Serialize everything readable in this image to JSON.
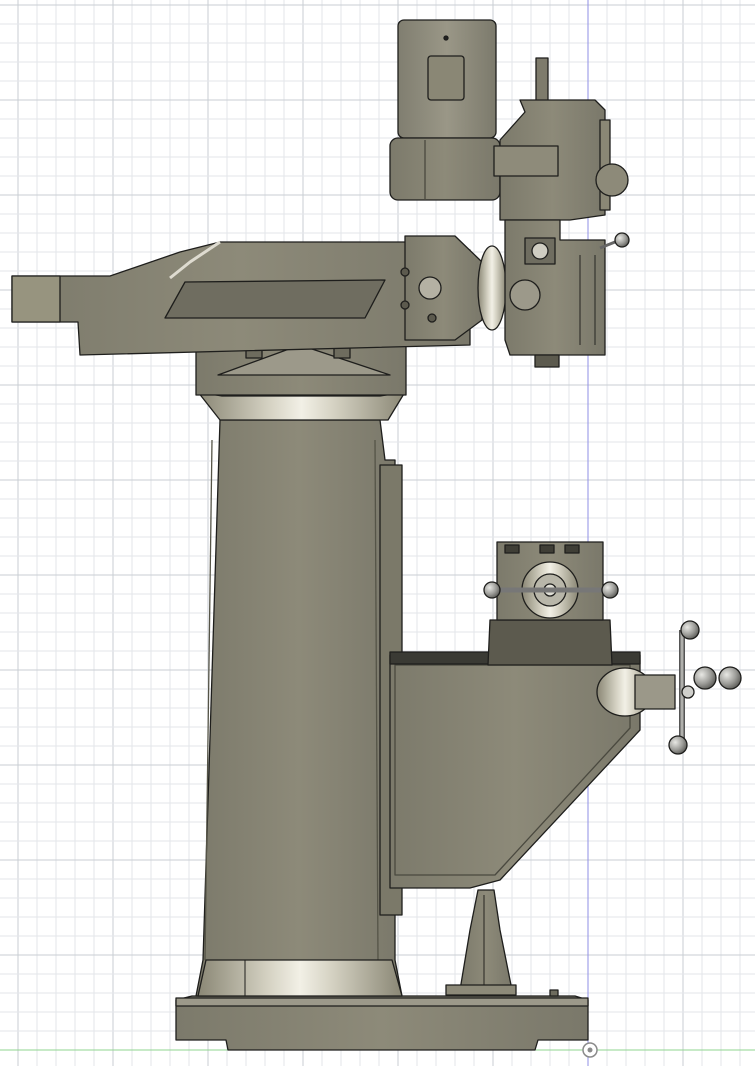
{
  "viewport": {
    "background": "#ffffff",
    "grid_minor_color": "#e3e6ea",
    "grid_major_color": "#c9cdd3",
    "axis_vertical_color": "#8f8fe6",
    "axis_horizontal_color": "#8fd48f"
  },
  "model": {
    "body_color": "#8a8775",
    "body_shadow": "#6e6c5e",
    "body_highlight": "#c9c6b6",
    "outline_color": "#1e1e1c",
    "steel_color": "#a9aaa6"
  },
  "icons": {
    "origin_marker": "origin-icon"
  }
}
